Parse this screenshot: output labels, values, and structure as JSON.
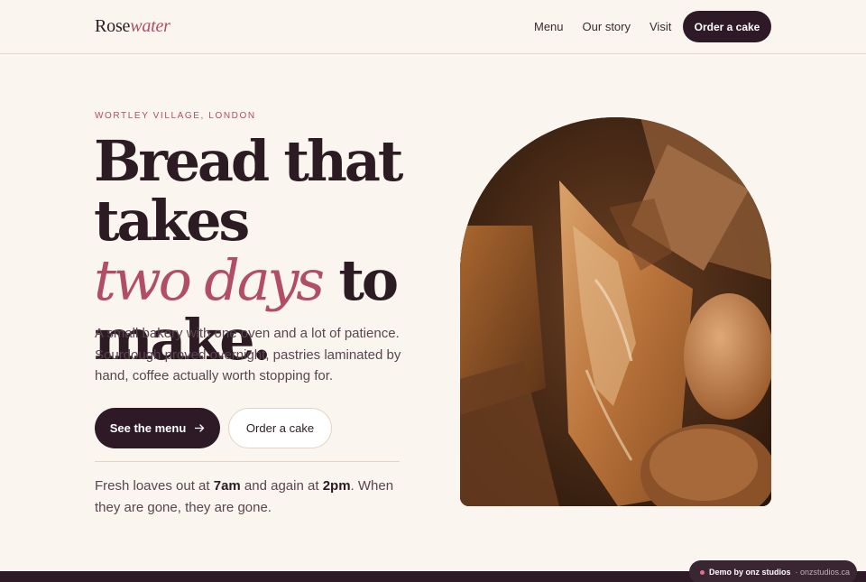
{
  "header": {
    "logo_main": "Rose",
    "logo_accent": "water",
    "nav": [
      "Menu",
      "Our story",
      "Visit"
    ],
    "cta_label": "Order a cake"
  },
  "hero": {
    "eyebrow": "WORTLEY VILLAGE, LONDON",
    "headline_line1": "Bread that takes",
    "headline_accent": "two days",
    "headline_to": "to",
    "headline_line3": "make.",
    "lede": "A small bakery with one oven and a lot of patience. Sourdough proved overnight, pastries laminated by hand, coffee actually worth stopping for.",
    "primary_label": "See the menu",
    "primary_icon": "arrow-right-icon",
    "secondary_label": "Order a cake",
    "note_prefix": "Fresh loaves out at ",
    "note_time1": "7am",
    "note_mid": " and again at ",
    "note_time2": "2pm",
    "note_suffix": ". When they are gone, they are gone."
  },
  "badge": {
    "label": "Demo by onz studios",
    "site": "· onzstudios.ca"
  },
  "colors": {
    "background": "#faf6ef",
    "ink": "#2d1b24",
    "accent": "#b24d66",
    "button_dark": "#2e1a26"
  }
}
